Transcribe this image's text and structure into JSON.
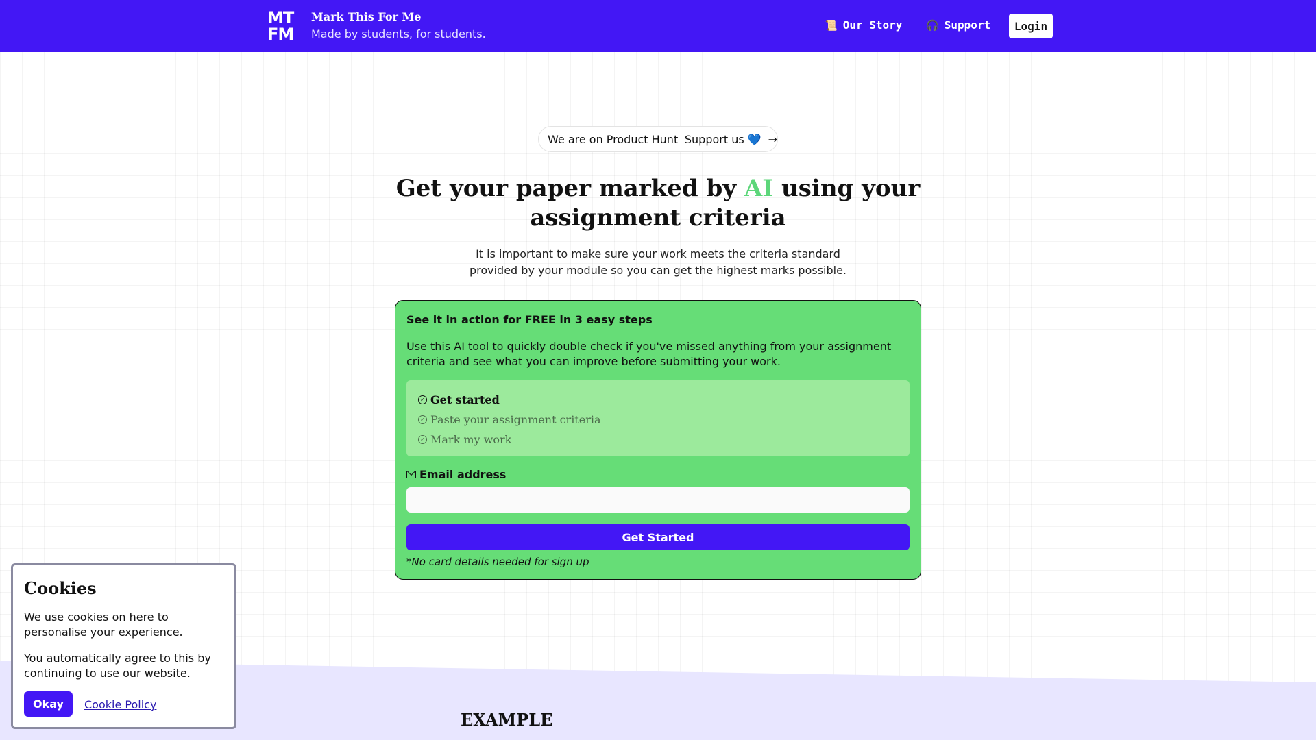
{
  "navbar": {
    "logo_line1": "MT",
    "logo_line2": "FM",
    "brand_title": "Mark This For Me",
    "brand_tagline": "Made by students, for students.",
    "links": [
      {
        "icon": "📜",
        "label": "Our Story"
      },
      {
        "icon": "🎧",
        "label": "Support"
      }
    ],
    "login_label": "Login"
  },
  "product_hunt": {
    "text": "We are on Product Hunt",
    "cta": "Support us",
    "heart": "💙",
    "arrow": "→"
  },
  "hero": {
    "title_before": "Get your paper marked by ",
    "title_highlight": "AI",
    "title_after": " using your assignment criteria",
    "description": "It is important to make sure your work meets the criteria standard provided by your module so you can get the highest marks possible."
  },
  "signup_card": {
    "heading": "See it in action for FREE in 3 easy steps",
    "description": "Use this AI tool to quickly double check if you've missed anything from your assignment criteria and see what you can improve before submitting your work.",
    "steps": [
      {
        "label": "Get started",
        "active": true
      },
      {
        "label": "Paste your assignment criteria",
        "active": false
      },
      {
        "label": "Mark my work",
        "active": false
      }
    ],
    "email_label": "Email address",
    "email_value": "",
    "email_placeholder": "",
    "submit_label": "Get Started",
    "note": "*No card details needed for sign up"
  },
  "example_section": {
    "heading": "EXAMPLE"
  },
  "cookie_banner": {
    "title": "Cookies",
    "paragraph1": "We use cookies on here to personalise your experience.",
    "paragraph2": "You automatically agree to this by continuing to use our website.",
    "accept_label": "Okay",
    "policy_link": "Cookie Policy"
  },
  "colors": {
    "brand": "#4317f5",
    "card_green": "#66dd77",
    "steps_green": "#9cea9c",
    "ai_highlight": "#5cd67a",
    "band": "#e8e6ff"
  }
}
